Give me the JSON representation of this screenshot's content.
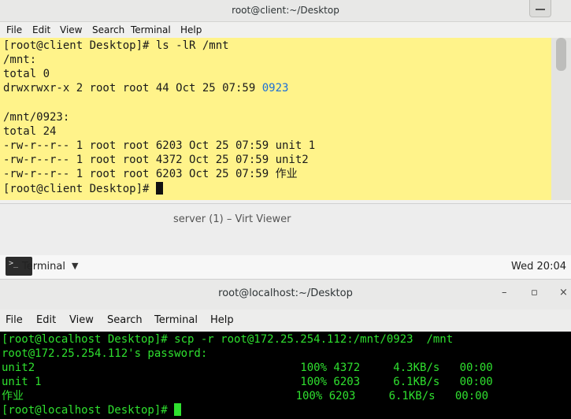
{
  "client_window": {
    "title": "root@client:~/Desktop",
    "menu": [
      "File",
      "Edit",
      "View",
      "Search",
      "Terminal",
      "Help"
    ],
    "lines": [
      "[root@client Desktop]# ls -lR /mnt",
      "/mnt:",
      "total 0",
      "drwxrwxr-x 2 root root 44 Oct 25 07:59 ",
      "",
      "/mnt/0923:",
      "total 24",
      "-rw-r--r-- 1 root root 6203 Oct 25 07:59 unit 1",
      "-rw-r--r-- 1 root root 4372 Oct 25 07:59 unit2",
      "-rw-r--r-- 1 root root 6203 Oct 25 07:59 作业",
      "[root@client Desktop]# "
    ],
    "dir_name": "0923",
    "colors": {
      "terminal_bg": "#fff38a",
      "dir_color": "#1c6fd6"
    }
  },
  "viewer": {
    "title": "server (1) – Virt Viewer"
  },
  "panel": {
    "app_label": "Terminal",
    "icon_glyph": ">_",
    "clock": "Wed 20:04"
  },
  "server_window": {
    "title": "root@localhost:~/Desktop",
    "controls": [
      "–",
      "▫",
      "×"
    ],
    "menu": [
      "File",
      "Edit",
      "View",
      "Search",
      "Terminal",
      "Help"
    ],
    "lines": [
      "[root@localhost Desktop]# scp -r root@172.25.254.112:/mnt/0923  /mnt",
      "root@172.25.254.112's password:",
      "unit2                                        100% 4372     4.3KB/s   00:00",
      "unit 1                                       100% 6203     6.1KB/s   00:00",
      "作业                                         100% 6203     6.1KB/s   00:00",
      "[root@localhost Desktop]# "
    ],
    "colors": {
      "terminal_bg": "#000000",
      "text": "#2fe02f"
    }
  }
}
